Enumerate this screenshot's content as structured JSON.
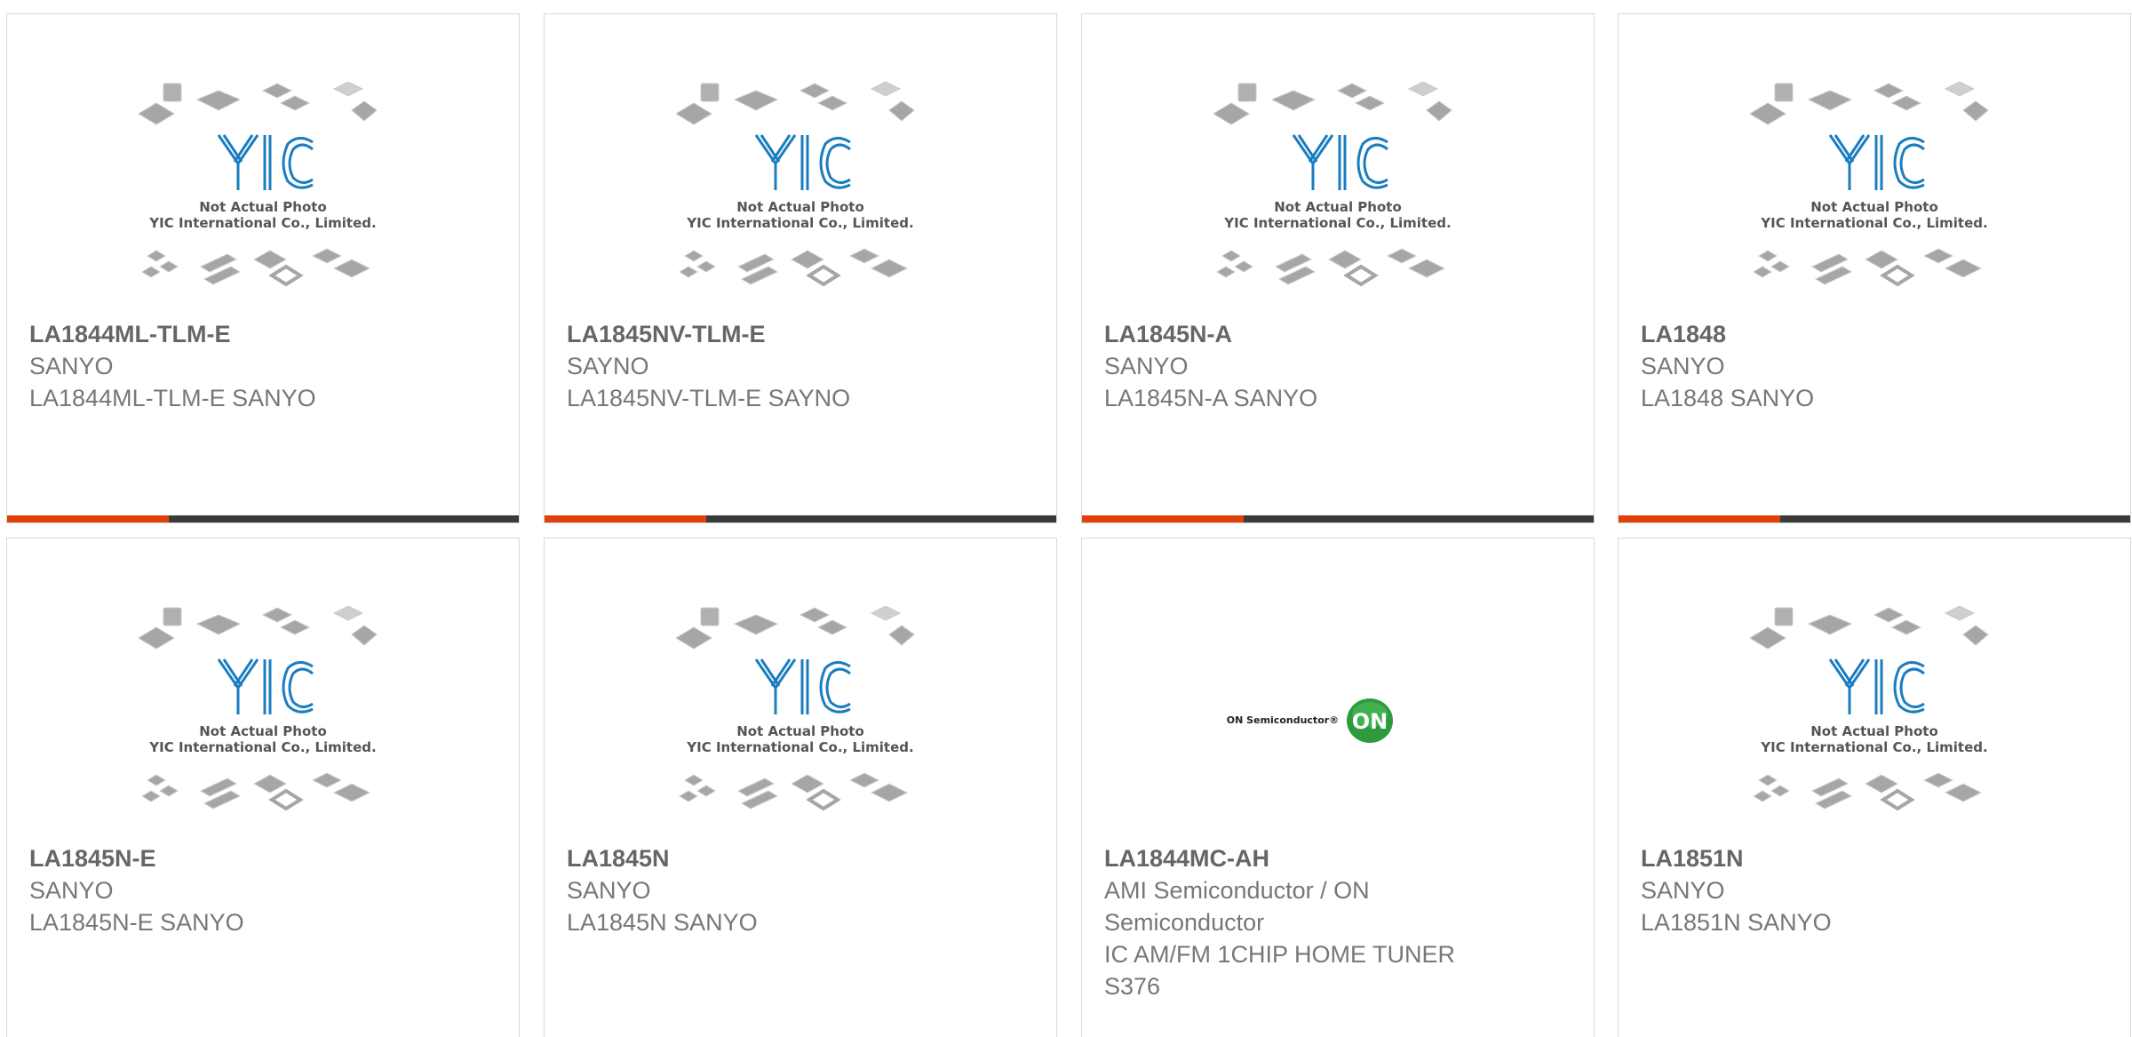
{
  "cards": [
    {
      "part": "LA1844ML-TLM-E",
      "maker": "SANYO",
      "desc": "LA1844ML-TLM-E SANYO",
      "image": "yic-placeholder"
    },
    {
      "part": "LA1845NV-TLM-E",
      "maker": "SAYNO",
      "desc": "LA1845NV-TLM-E SAYNO",
      "image": "yic-placeholder"
    },
    {
      "part": "LA1845N-A",
      "maker": "SANYO",
      "desc": "LA1845N-A SANYO",
      "image": "yic-placeholder"
    },
    {
      "part": "LA1848",
      "maker": "SANYO",
      "desc": "LA1848 SANYO",
      "image": "yic-placeholder"
    },
    {
      "part": "LA1845N-E",
      "maker": "SANYO",
      "desc": "LA1845N-E SANYO",
      "image": "yic-placeholder"
    },
    {
      "part": "LA1845N",
      "maker": "SANYO",
      "desc": "LA1845N SANYO",
      "image": "yic-placeholder"
    },
    {
      "part": "LA1844MC-AH",
      "maker": "AMI Semiconductor / ON Semiconductor",
      "desc": "IC AM/FM 1CHIP HOME TUNER S376",
      "image": "on-semiconductor-logo"
    },
    {
      "part": "LA1851N",
      "maker": "SANYO",
      "desc": "LA1851N SANYO",
      "image": "yic-placeholder"
    }
  ],
  "placeholder": {
    "logo_text": "YIC",
    "line1": "Not Actual Photo",
    "line2": "YIC International Co., Limited."
  },
  "on_logo": {
    "wordmark": "ON Semiconductor®",
    "badge": "ON"
  },
  "colors": {
    "accent": "#e2400c",
    "bar": "#3a3a3a",
    "yic_blue": "#1a7dc0",
    "on_green": "#2e9a3e"
  }
}
